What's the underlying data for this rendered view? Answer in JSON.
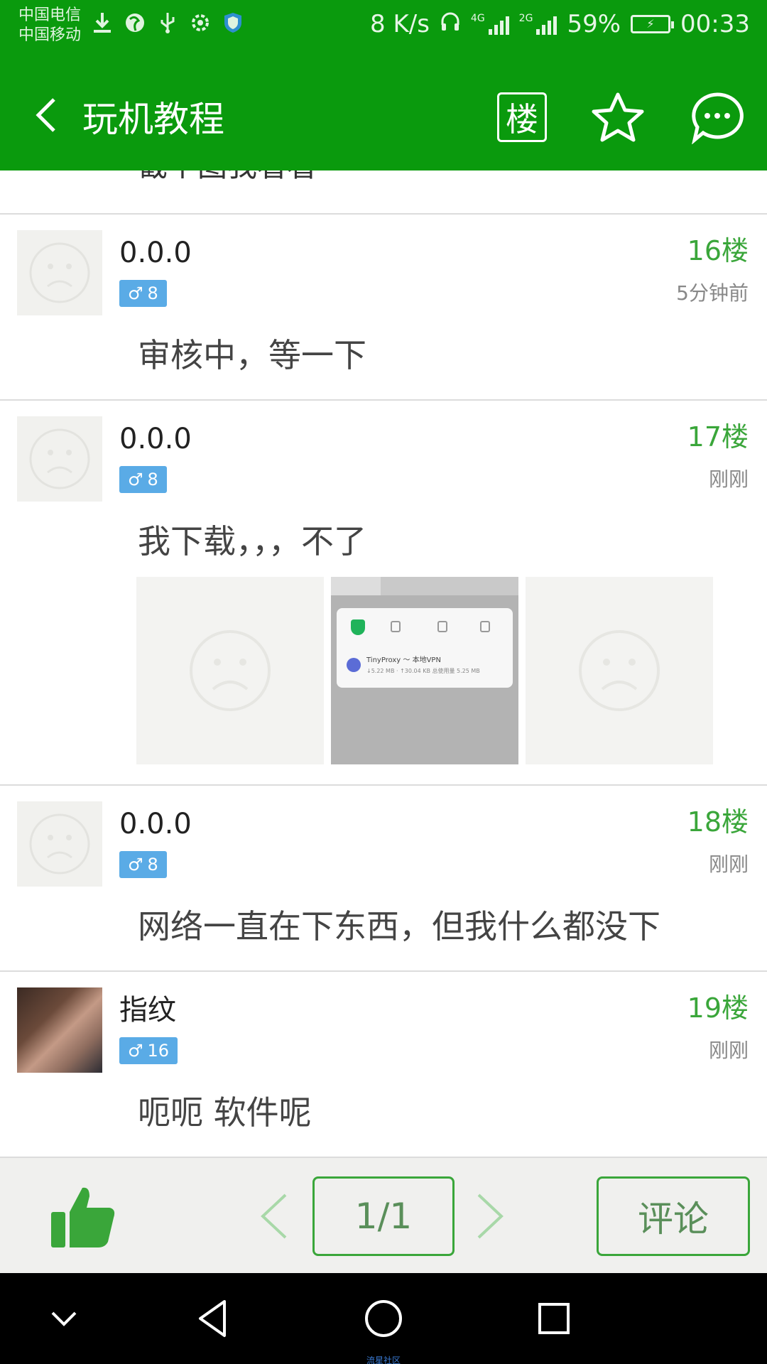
{
  "status_bar": {
    "carrier_1": "中国电信",
    "carrier_2": "中国移动",
    "net_speed": "8 K/s",
    "tag_4g": "4G",
    "tag_2g": "2G",
    "battery": "59%",
    "time": "00:33",
    "icons": [
      "download-icon",
      "browser-icon",
      "usb-icon",
      "settings-icon",
      "shield-icon",
      "headphones-icon",
      "signal-icon",
      "battery-charging-icon"
    ]
  },
  "header": {
    "title": "玩机教程",
    "floor_button": "楼",
    "accent_color": "#0a9a0d"
  },
  "previous_post_tail": "截个图我看看",
  "posts": [
    {
      "username": "0.0.0",
      "level": "8",
      "floor": "16楼",
      "time": "5分钟前",
      "text": "审核中，等一下"
    },
    {
      "username": "0.0.0",
      "level": "8",
      "floor": "17楼",
      "time": "刚刚",
      "text": "我下载，，，不了",
      "image_screenshot": {
        "line1": "TinyProxy ～ 本地VPN",
        "line2": "↓5.22 MB · ↑30.04 KB 总使用量 5.25 MB"
      }
    },
    {
      "username": "0.0.0",
      "level": "8",
      "floor": "18楼",
      "time": "刚刚",
      "text": "网络一直在下东西，但我什么都没下"
    },
    {
      "username": "指纹",
      "level": "16",
      "floor": "19楼",
      "time": "刚刚",
      "text": "呃呃 软件呢"
    }
  ],
  "action_bar": {
    "page_indicator": "1/1",
    "comment_label": "评论",
    "green": "#3aa63a"
  },
  "footer_watermark": "流星社区"
}
